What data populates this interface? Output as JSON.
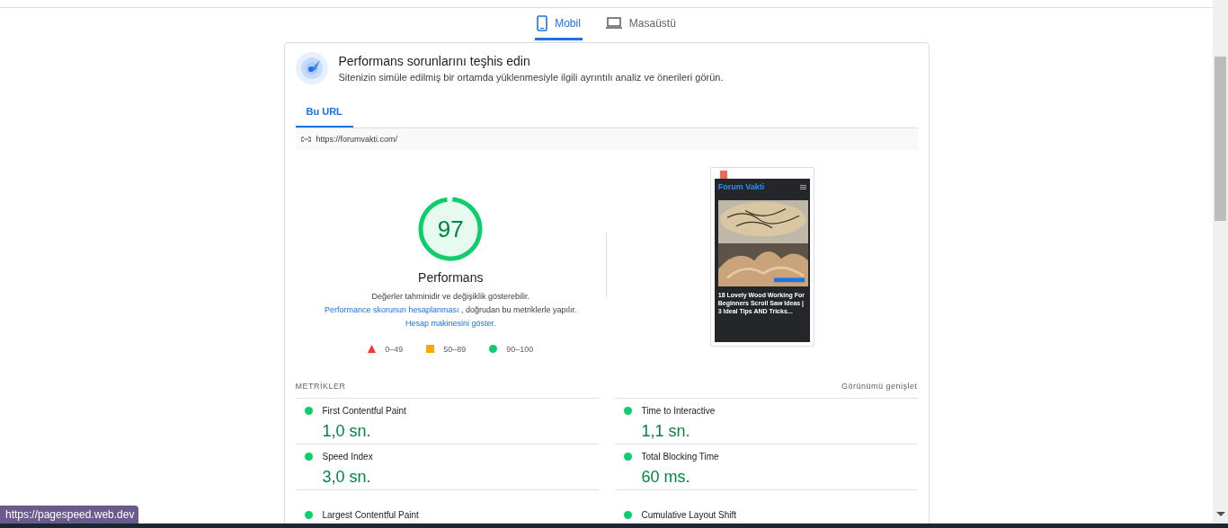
{
  "tabs": [
    {
      "label": "Mobil",
      "selected": true,
      "kind": "phone"
    },
    {
      "label": "Masaüstü",
      "selected": false,
      "kind": "laptop"
    }
  ],
  "header": {
    "title": "Performans sorunlarını teşhis edin",
    "subtitle": "Sitenizin simüle edilmiş bir ortamda yüklenmesiyle ilgili ayrıntılı analiz ve önerileri görün."
  },
  "url_tabs": [
    {
      "label": "Bu URL",
      "selected": true
    }
  ],
  "url": "https://forumvakti.com/",
  "score": {
    "value": "97",
    "label": "Performans"
  },
  "description": [
    {
      "kind": "text",
      "text": "Değerler tahminidir ve değişiklik gösterebilir."
    },
    {
      "kind": "link",
      "text": "Performance skorunun hesaplanması"
    },
    {
      "kind": "text",
      "text": ", doğrudan bu metriklerle yapılır."
    },
    {
      "kind": "link",
      "text": "Hesap makinesini göster."
    }
  ],
  "legend": [
    {
      "label": "0–49",
      "kind": "triangle",
      "color": "#ff3333"
    },
    {
      "label": "50–89",
      "kind": "square",
      "color": "#ffa400"
    },
    {
      "label": "90–100",
      "kind": "circle",
      "color": "#0cce6b"
    }
  ],
  "thumbnail": {
    "site_title": "Forum Vakti",
    "article_title": "18 Lovely Wood Working For Beginners Scroll Saw Ideas | 3 Ideal Tips AND Tricks..."
  },
  "metrics": {
    "heading": "METRİKLER",
    "expand": "Görünümü genişlet",
    "items": [
      {
        "name": "First Contentful Paint",
        "value": "1,0 sn."
      },
      {
        "name": "Time to Interactive",
        "value": "1,1 sn."
      },
      {
        "name": "Speed Index",
        "value": "3,0 sn."
      },
      {
        "name": "Total Blocking Time",
        "value": "60 ms."
      },
      {
        "name": "Largest Contentful Paint"
      },
      {
        "name": "Cumulative Layout Shift"
      }
    ]
  },
  "status_tooltip": "https://pagespeed.web.dev"
}
